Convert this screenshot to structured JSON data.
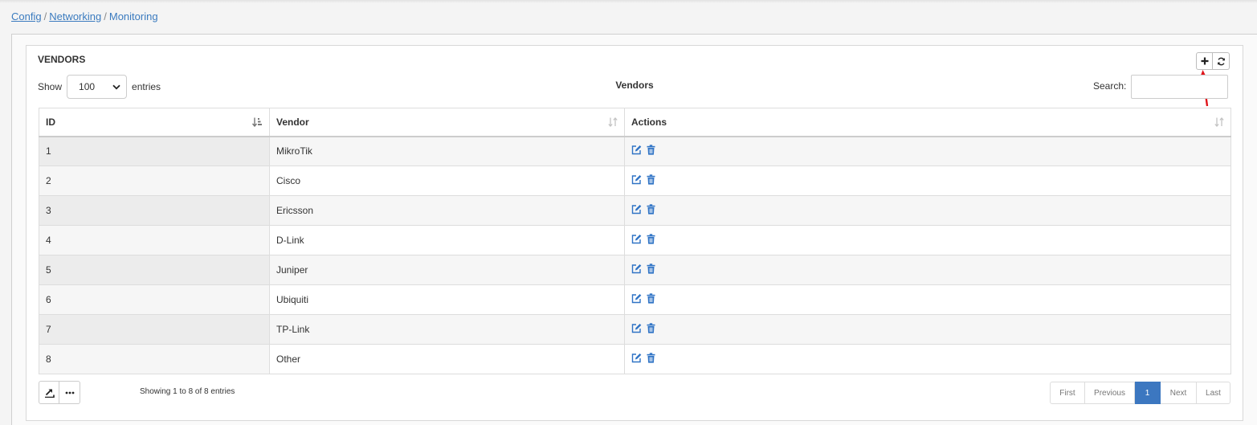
{
  "breadcrumb": {
    "items": [
      "Config",
      "Networking"
    ],
    "current": "Monitoring"
  },
  "panel": {
    "title": "VENDORS",
    "center_title": "Vendors"
  },
  "toolbar": {
    "add_icon": "plus-icon",
    "refresh_icon": "refresh-icon"
  },
  "length": {
    "show_label": "Show",
    "value": "100",
    "entries_label": "entries"
  },
  "search": {
    "label": "Search:",
    "value": ""
  },
  "table": {
    "columns": [
      "ID",
      "Vendor",
      "Actions"
    ],
    "rows": [
      {
        "id": "1",
        "vendor": "MikroTik"
      },
      {
        "id": "2",
        "vendor": "Cisco"
      },
      {
        "id": "3",
        "vendor": "Ericsson"
      },
      {
        "id": "4",
        "vendor": "D-Link"
      },
      {
        "id": "5",
        "vendor": "Juniper"
      },
      {
        "id": "6",
        "vendor": "Ubiquiti"
      },
      {
        "id": "7",
        "vendor": "TP-Link"
      },
      {
        "id": "8",
        "vendor": "Other"
      }
    ]
  },
  "footer": {
    "info": "Showing 1 to 8 of 8 entries"
  },
  "pagination": {
    "first": "First",
    "previous": "Previous",
    "current": "1",
    "next": "Next",
    "last": "Last"
  },
  "colors": {
    "link": "#3b7bbf",
    "accent": "#3c77c0",
    "annotation": "#e0141a"
  }
}
